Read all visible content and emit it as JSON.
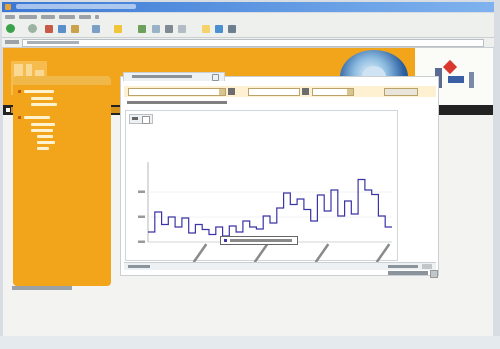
{
  "browser": {
    "title": "",
    "address": ""
  },
  "chart_data": {
    "type": "line",
    "step": true,
    "title": "",
    "xlabel": "",
    "ylabel": "",
    "ylim": [
      0,
      1600
    ],
    "x_tick_labels": [
      "",
      "",
      "",
      ""
    ],
    "y_tick_labels": [
      "",
      "",
      ""
    ],
    "series": [
      {
        "values": [
          200,
          600,
          350,
          500,
          300,
          480,
          180,
          350,
          250,
          150,
          300,
          120,
          320,
          200,
          420,
          300,
          260,
          520,
          380,
          680,
          980,
          750,
          860,
          650,
          420,
          940,
          620,
          1040,
          520,
          820,
          560,
          1250,
          1040,
          950,
          520,
          300
        ],
        "color": "#3a34a6"
      }
    ]
  },
  "colors": {
    "header": "#f2a41a",
    "sidebar": "#f2a41a",
    "series": "#3a34a6",
    "filter_bg": "#fdf1d2"
  }
}
